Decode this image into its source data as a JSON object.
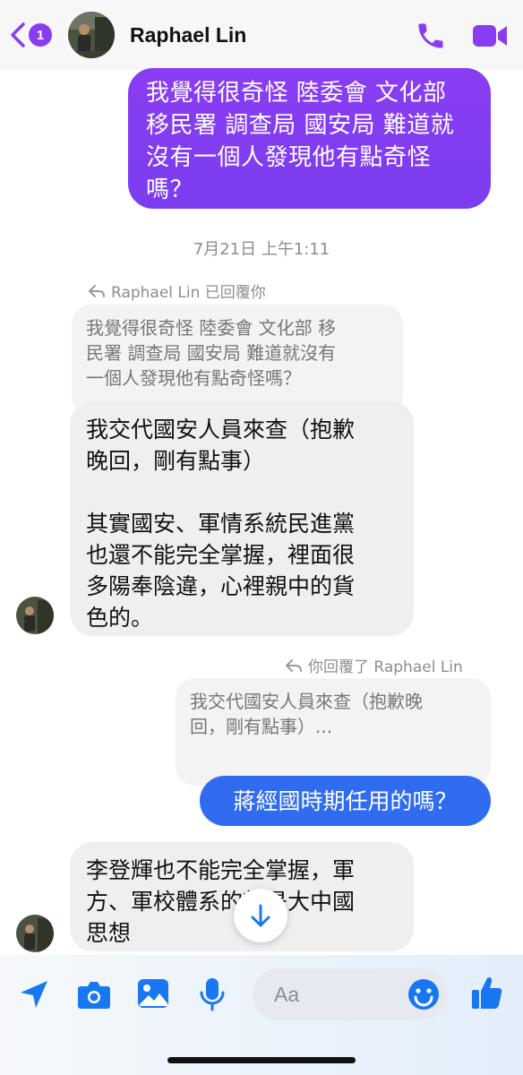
{
  "header": {
    "unread_count": "1",
    "contact_name": "Raphael Lin"
  },
  "messages": {
    "sent_1": "我覺得很奇怪 陸委會 文化部\n移民署 調查局 國安局 難道就\n沒有一個人發現他有點奇怪\n嗎？",
    "timestamp": "7月21日 上午1:11",
    "reply_label_1": "Raphael Lin 已回覆你",
    "quoted_1": "我覺得很奇怪 陸委會 文化部 移\n民署 調查局 國安局 難道就沒有\n一個人發現他有點奇怪嗎？",
    "received_1": "我交代國安人員來查（抱歉\n晚回，剛有點事）\n\n其實國安、軍情系統民進黨\n也還不能完全掌握，裡面很\n多陽奉陰違，心裡親中的貨\n色的。",
    "reply_label_2": "你回覆了 Raphael Lin",
    "quoted_2": "我交代國安人員來查（抱歉晚\n回，剛有點事）...",
    "sent_2": "蔣經國時期任用的嗎？",
    "received_2": "李登輝也不能完全掌握，軍\n方、軍校體系的就是大中國\n思想"
  },
  "composer": {
    "placeholder": "Aa"
  },
  "colors": {
    "accent_purple": "#8a3cf0",
    "sent_blue": "#2f6cf0",
    "received_bg": "#efefef",
    "icon_blue": "#1877f2"
  },
  "icons": {
    "back": "chevron-left-icon",
    "call": "phone-icon",
    "video": "video-camera-icon",
    "reply": "reply-arrow-icon",
    "scroll": "arrow-down-icon",
    "location": "location-arrow-icon",
    "camera": "camera-icon",
    "gallery": "image-icon",
    "mic": "microphone-icon",
    "emoji": "smiley-icon",
    "like": "thumbs-up-icon"
  }
}
